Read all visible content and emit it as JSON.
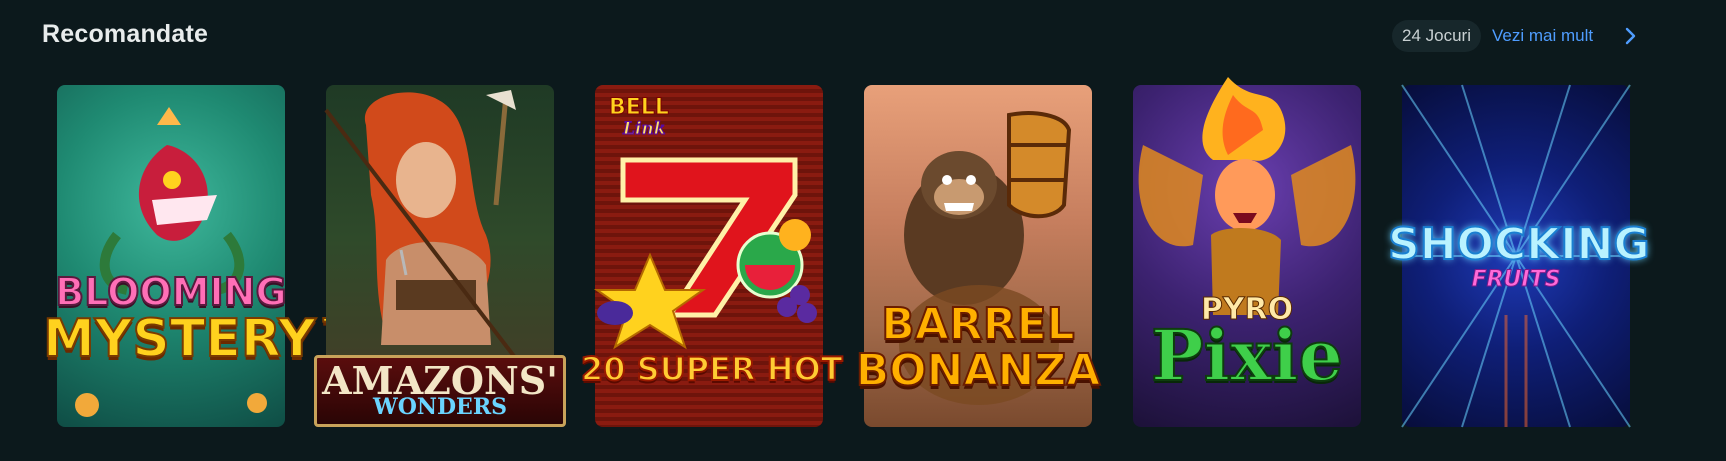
{
  "section": {
    "title": "Recomandate",
    "count_badge": "24 Jocuri",
    "more_link": "Vezi mai mult"
  },
  "games": [
    {
      "logo_line1": "BLOOMING",
      "logo_line2": "MYSTERY™"
    },
    {
      "logo_line1": "AMAZONS'",
      "logo_line2": "WONDERS"
    },
    {
      "logo_top1": "BELL",
      "logo_top2": "Link",
      "logo_line1": "20 SUPER HOT"
    },
    {
      "logo_line1": "BARREL",
      "logo_line2": "BONANZA"
    },
    {
      "logo_line1": "PYRO",
      "logo_line2": "Pixie"
    },
    {
      "logo_line1": "SHOCKING",
      "logo_line2": "FRUITS"
    }
  ],
  "colors": {
    "background": "#0c191c",
    "link": "#4f9dff",
    "badge_bg": "#17272b"
  },
  "icons": {
    "more": "chevron-right-icon"
  }
}
